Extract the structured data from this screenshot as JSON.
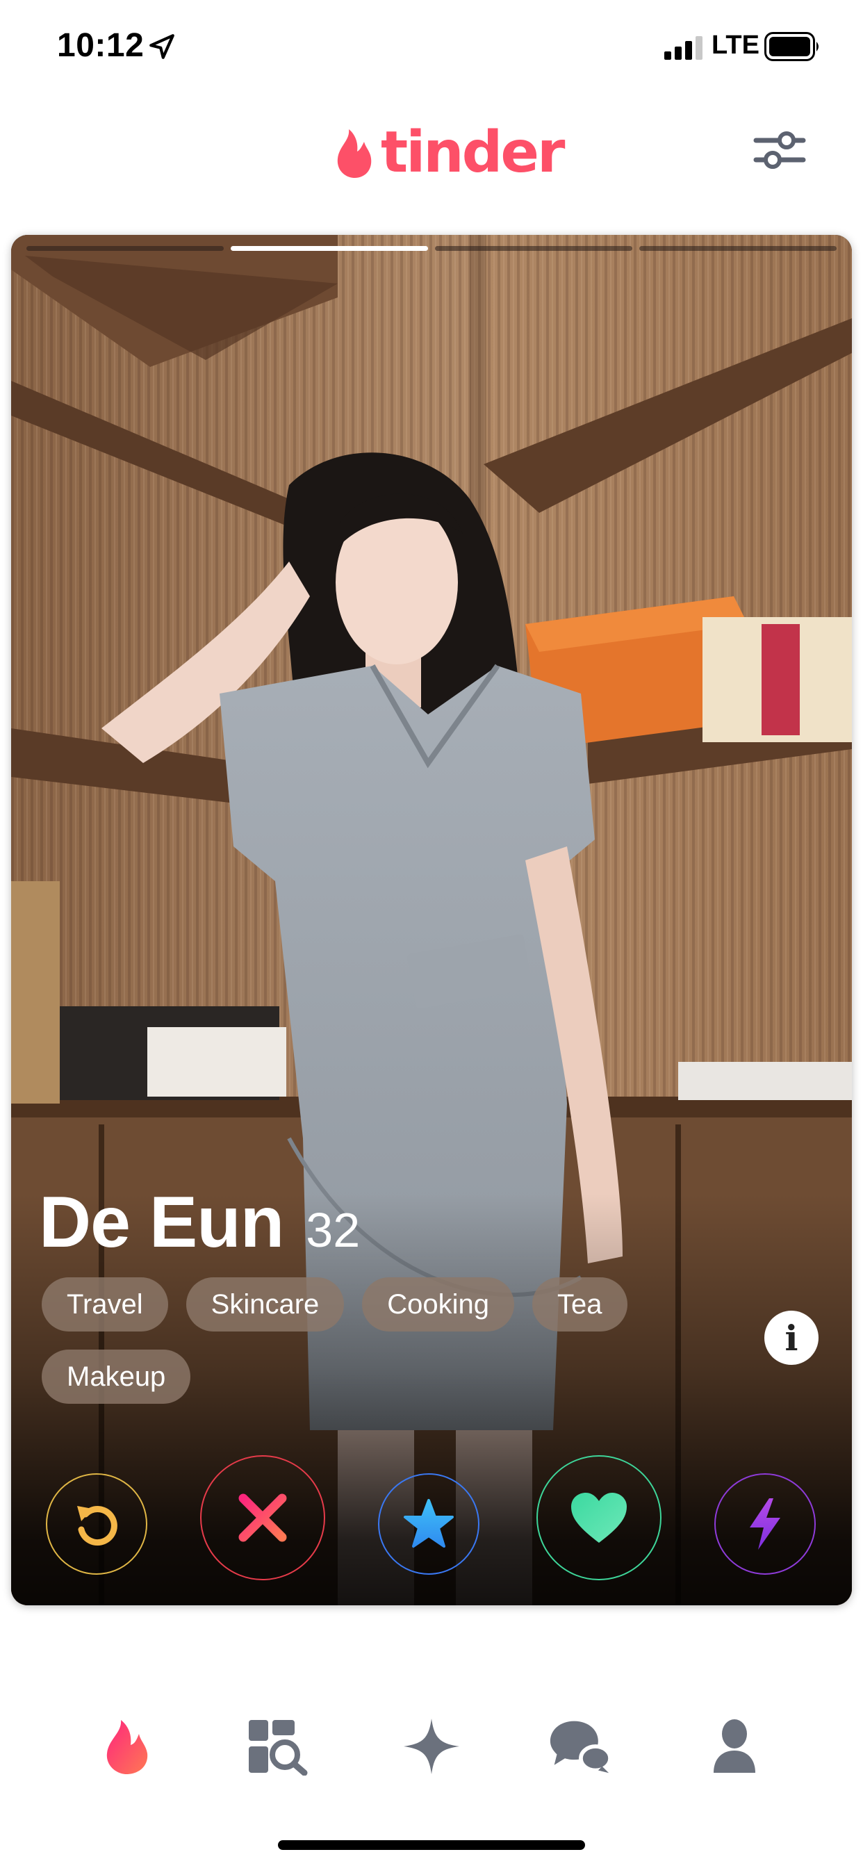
{
  "status_bar": {
    "time": "10:12",
    "network": "LTE",
    "location_icon": "location-arrow-icon",
    "signal_icon": "signal-bars-icon",
    "battery_icon": "battery-icon"
  },
  "header": {
    "logo_text": "tinder",
    "logo_icon": "flame-icon",
    "filters_icon": "sliders-icon",
    "brand_color": "#fd5068"
  },
  "card": {
    "photo_count": 4,
    "active_photo_index": 1,
    "name": "De Eun",
    "age": "32",
    "tags": [
      "Travel",
      "Skincare",
      "Cooking",
      "Tea",
      "Makeup"
    ],
    "info_label": "i"
  },
  "actions": [
    {
      "name": "rewind",
      "icon": "rewind-icon",
      "color": "#f5b748"
    },
    {
      "name": "nope",
      "icon": "close-icon",
      "color": "#fd4f63"
    },
    {
      "name": "super-like",
      "icon": "star-icon",
      "color": "#3fa9f5"
    },
    {
      "name": "like",
      "icon": "heart-icon",
      "color": "#4ee0a5"
    },
    {
      "name": "boost",
      "icon": "lightning-icon",
      "color": "#a53ef0"
    }
  ],
  "bottom_nav": [
    {
      "name": "home",
      "icon": "flame-icon",
      "active": true
    },
    {
      "name": "explore",
      "icon": "explore-grid-icon",
      "active": false
    },
    {
      "name": "gold",
      "icon": "sparkle-icon",
      "active": false
    },
    {
      "name": "messages",
      "icon": "chat-bubbles-icon",
      "active": false
    },
    {
      "name": "profile",
      "icon": "person-icon",
      "active": false
    }
  ]
}
